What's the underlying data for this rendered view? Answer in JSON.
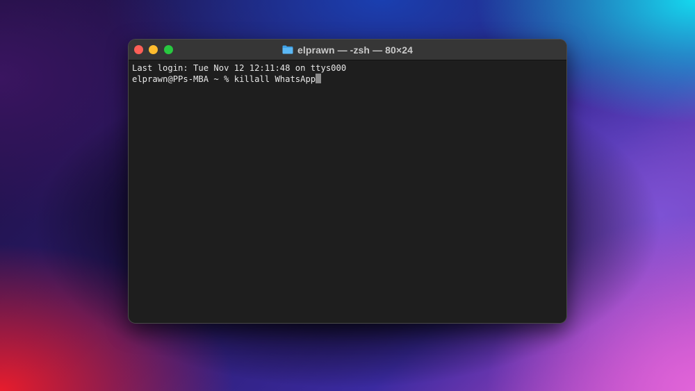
{
  "window": {
    "title": "elprawn — -zsh — 80×24",
    "folder_icon": "folder-icon"
  },
  "terminal": {
    "lines": [
      "Last login: Tue Nov 12 12:11:48 on ttys000",
      "elprawn@PPs-MBA ~ % killall WhatsApp"
    ]
  },
  "colors": {
    "close": "#fe5f57",
    "minimize": "#febc2e",
    "maximize": "#28c840",
    "terminal_bg": "#1e1e1e"
  }
}
